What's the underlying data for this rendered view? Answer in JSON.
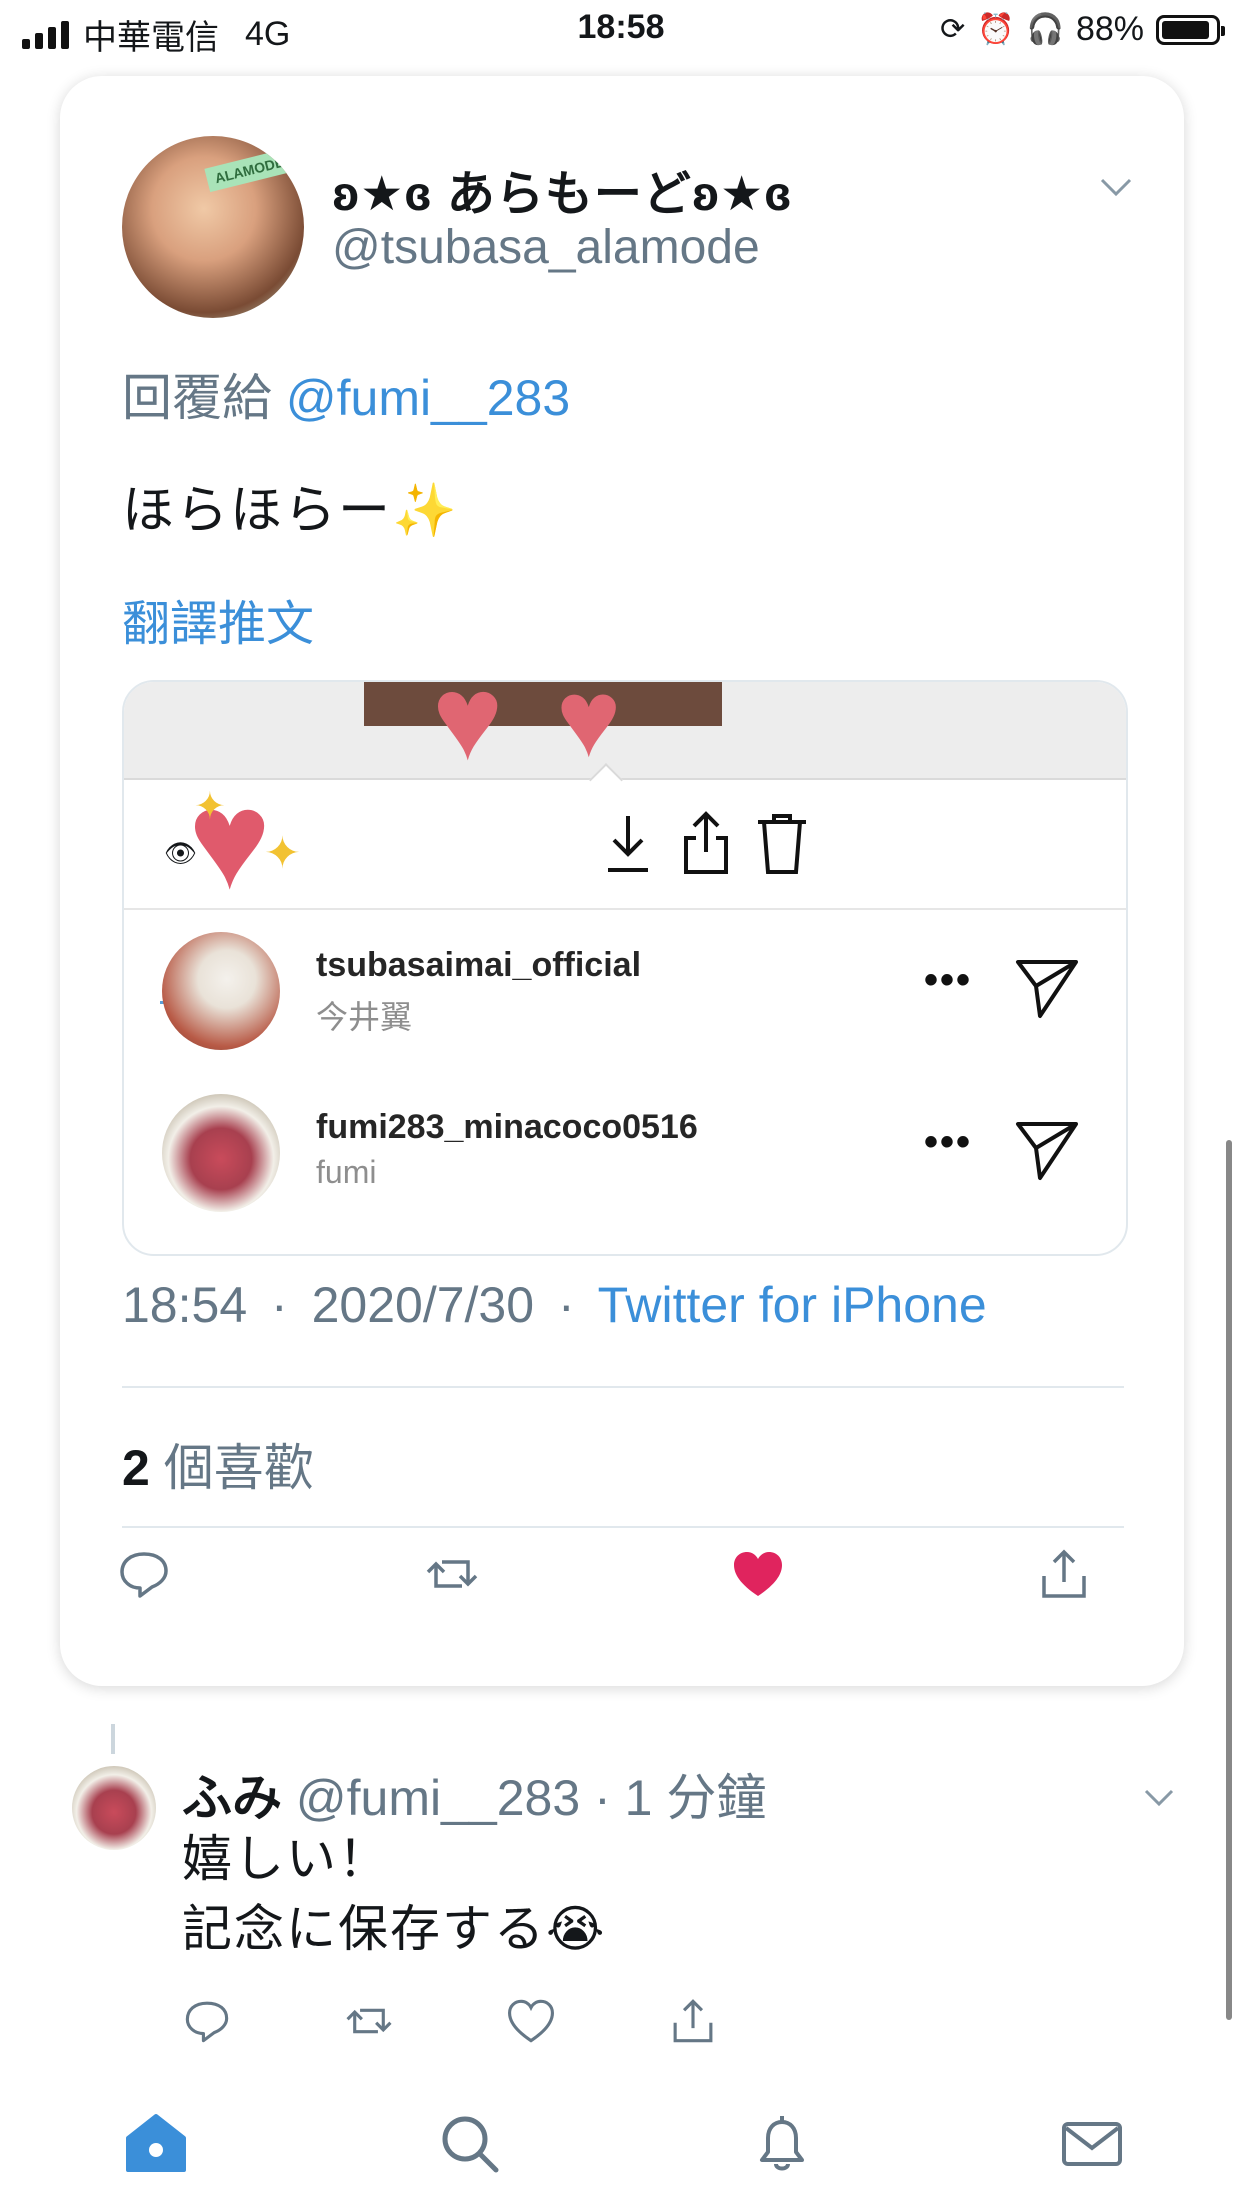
{
  "status_bar": {
    "carrier": "中華電信",
    "network": "4G",
    "time": "18:58",
    "battery": "88%"
  },
  "tweet": {
    "display_name": "ʚ★ɞ あらもーどʚ★ɞ",
    "handle": "@tsubasa_alamode",
    "reply_prefix": "回覆給",
    "reply_mention": "@fumi__283",
    "text": "ほらほらー",
    "text_emoji": "✨",
    "translate_label": "翻譯推文",
    "time": "18:54",
    "date": "2020/7/30",
    "source": "Twitter for iPhone",
    "meta_separator": "·",
    "like_count": "2",
    "like_label": "個喜歡",
    "like_color": "#e0245e",
    "avatar_tag": "ALAMODE"
  },
  "media": {
    "users": [
      {
        "username": "tsubasaimai_official",
        "subtitle": "今井翼"
      },
      {
        "username": "fumi283_minacoco0516",
        "subtitle": "fumi"
      }
    ],
    "dots": "•••"
  },
  "reply": {
    "name": "ふみ",
    "handle": "@fumi__283",
    "separator": "·",
    "time_ago": "1 分鐘",
    "line1": "嬉しい！",
    "line2": "記念に保存する",
    "line2_emoji": "😭"
  },
  "colors": {
    "accent": "#3b8fd9",
    "secondary_text": "#657786",
    "heart": "#e0245e"
  }
}
